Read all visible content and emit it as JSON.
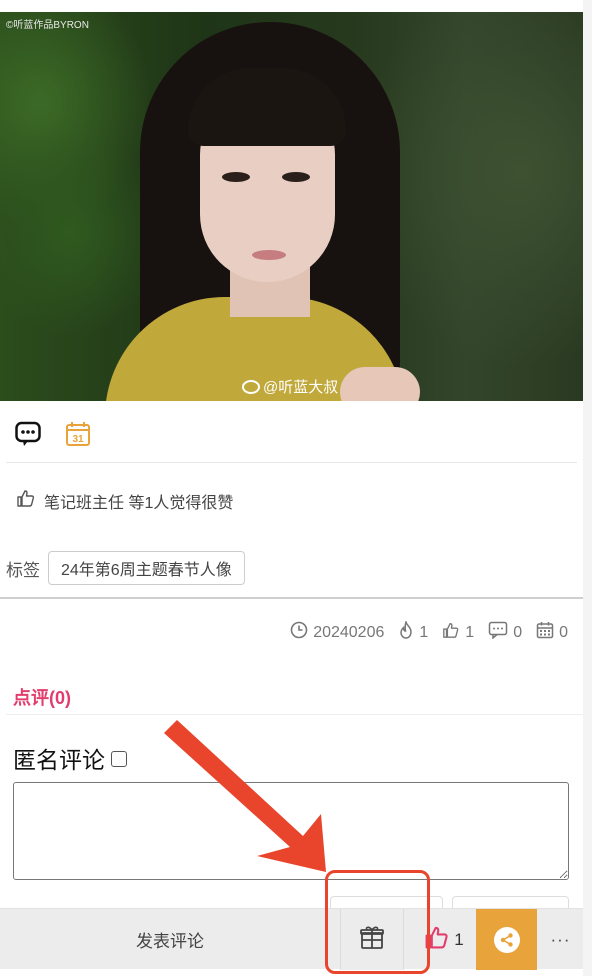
{
  "photo": {
    "copyright_text": "©听蓝作品BYRON",
    "watermark_text": "@听蓝大叔"
  },
  "icon_row": {
    "comment_icon": "chat-bubble-icon",
    "calendar_icon": "calendar-31-icon",
    "calendar_day": "31"
  },
  "likes": {
    "text": "笔记班主任 等1人觉得很赞"
  },
  "tags": {
    "label": "标签",
    "items": [
      "24年第6周主题春节人像"
    ]
  },
  "stats": {
    "date": "20240206",
    "views": "1",
    "likes": "1",
    "comments": "0",
    "calendar": "0"
  },
  "review": {
    "title": "点评(0)",
    "anonymous_label": "匿名评论"
  },
  "bottom_bar": {
    "post_label": "发表评论",
    "like_count": "1",
    "more_label": "···",
    "share_color": "#e8a33b",
    "like_color": "#e23d6d"
  },
  "annotation": {
    "color": "#e8452c"
  }
}
